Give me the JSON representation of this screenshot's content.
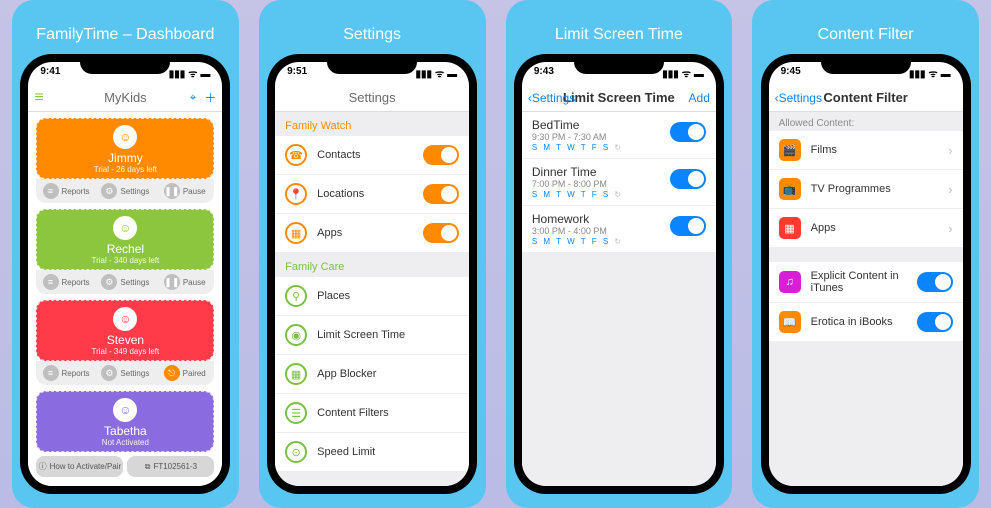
{
  "cards": [
    {
      "caption": "FamilyTime – Dashboard",
      "time": "9:41",
      "navTitle": "MyKids"
    },
    {
      "caption": "Settings",
      "time": "9:51",
      "navTitle": "Settings"
    },
    {
      "caption": "Limit Screen Time",
      "time": "9:43",
      "navTitle": "Limit Screen Time",
      "back": "Settings",
      "add": "Add"
    },
    {
      "caption": "Content Filter",
      "time": "9:45",
      "navTitle": "Content Filter",
      "back": "Settings"
    }
  ],
  "kids": [
    {
      "name": "Jimmy",
      "sub": "Trial - 26 days left",
      "color": "#ff8a00",
      "btn3": "Pause",
      "b3c": "#bfbfbf"
    },
    {
      "name": "Rechel",
      "sub": "Trial - 340 days left",
      "color": "#8cc63f",
      "btn3": "Pause",
      "b3c": "#bfbfbf"
    },
    {
      "name": "Steven",
      "sub": "Trial - 349 days left",
      "color": "#ff3b4a",
      "btn3": "Paired",
      "b3c": "#ff8a00"
    },
    {
      "name": "Tabetha",
      "sub": "Not Activated",
      "color": "#8a6ce0",
      "btn3": "",
      "b3c": "#bfbfbf"
    }
  ],
  "kidBtnLabels": {
    "reports": "Reports",
    "settings": "Settings"
  },
  "strip": {
    "left": "How to Activate/Pair",
    "right": "FT102561-3"
  },
  "settings": {
    "watchHeader": "Family Watch",
    "watch": [
      {
        "l": "Contacts",
        "g": "☎"
      },
      {
        "l": "Locations",
        "g": "📍"
      },
      {
        "l": "Apps",
        "g": "▦"
      }
    ],
    "careHeader": "Family Care",
    "care": [
      {
        "l": "Places",
        "g": "⚲"
      },
      {
        "l": "Limit Screen Time",
        "g": "◉"
      },
      {
        "l": "App Blocker",
        "g": "▦"
      },
      {
        "l": "Content Filters",
        "g": "☰"
      },
      {
        "l": "Speed Limit",
        "g": "⊙"
      }
    ]
  },
  "limits": [
    {
      "t": "BedTime",
      "tm": "9:30 PM - 7:30 AM"
    },
    {
      "t": "Dinner Time",
      "tm": "7:00 PM - 8:00 PM"
    },
    {
      "t": "Homework",
      "tm": "3:00 PM - 4:00 PM"
    }
  ],
  "daysOn": "S M T W T F S",
  "repeat": "↻",
  "filter": {
    "header": "Allowed Content:",
    "nav": [
      {
        "l": "Films",
        "c": "or",
        "g": "🎬"
      },
      {
        "l": "TV Programmes",
        "c": "or",
        "g": "📺"
      },
      {
        "l": "Apps",
        "c": "rd",
        "g": "▦"
      }
    ],
    "tog": [
      {
        "l": "Explicit Content in iTunes",
        "c": "mg",
        "g": "♫"
      },
      {
        "l": "Erotica in iBooks",
        "c": "or",
        "g": "📖"
      }
    ]
  }
}
